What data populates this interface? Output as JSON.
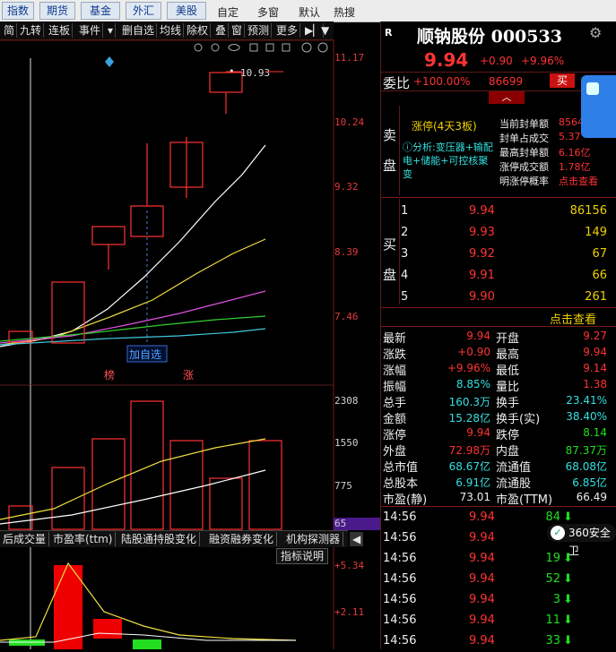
{
  "toolbar": {
    "tabs": [
      "指数",
      "期货",
      "基金",
      "外汇",
      "美股"
    ],
    "links": [
      "自定",
      "多窗",
      "默认",
      "热搜"
    ]
  },
  "chart_toolbar": {
    "items": [
      "简",
      "九转",
      "连板",
      "事件",
      "▾",
      "删自选",
      "均线",
      "除权",
      "叠",
      "窗",
      "预测",
      "更多"
    ]
  },
  "kline": {
    "price_labels": [
      "11.17",
      "10.24",
      "9.32",
      "8.39",
      "7.46"
    ],
    "high_label": "10.93",
    "add_watch": "加自选",
    "markers": [
      "榜",
      "涨"
    ]
  },
  "volume": {
    "labels": [
      "2308",
      "1550",
      "775"
    ],
    "bottom_label": "65"
  },
  "bottom_tabs": [
    "后成交量",
    "市盈率(ttm)",
    "陆股通持股变化",
    "融资融券变化",
    "机构探测器"
  ],
  "indicator": {
    "button": "指标说明",
    "labels": [
      "+5.34",
      "+2.11"
    ]
  },
  "stock": {
    "name": "顺钠股份 000533",
    "price": "9.94",
    "change": "+0.90",
    "pct": "+9.96%",
    "weibi_label": "委比",
    "weibi_value": "+100.00%",
    "weibi_count": "86699",
    "sell_btn": "买"
  },
  "limit_info": {
    "sell_label": "卖盘",
    "status": "涨停(4天3板)",
    "analysis": "ⓘ分析:变压器+输配电+储能+可控核聚变",
    "rows": [
      {
        "k": "当前封单额",
        "v": "8564"
      },
      {
        "k": "封单占成交",
        "v": "5.37"
      },
      {
        "k": "最高封单额",
        "v": "6.16亿"
      },
      {
        "k": "涨停成交额",
        "v": "1.78亿"
      },
      {
        "k": "明涨停概率",
        "v": "点击查看"
      }
    ]
  },
  "order_book": {
    "label": "买盘",
    "rows": [
      {
        "level": "1",
        "price": "9.94",
        "vol": "86156"
      },
      {
        "level": "2",
        "price": "9.93",
        "vol": "149"
      },
      {
        "level": "3",
        "price": "9.92",
        "vol": "67"
      },
      {
        "level": "4",
        "price": "9.91",
        "vol": "66"
      },
      {
        "level": "5",
        "price": "9.90",
        "vol": "261"
      }
    ],
    "view_link": "点击查看"
  },
  "stats": [
    {
      "k1": "最新",
      "v1": "9.94",
      "c1": "red",
      "k2": "开盘",
      "v2": "9.27",
      "c2": "red"
    },
    {
      "k1": "涨跌",
      "v1": "+0.90",
      "c1": "red",
      "k2": "最高",
      "v2": "9.94",
      "c2": "red"
    },
    {
      "k1": "涨幅",
      "v1": "+9.96%",
      "c1": "red",
      "k2": "最低",
      "v2": "9.14",
      "c2": "red"
    },
    {
      "k1": "振幅",
      "v1": "8.85%",
      "c1": "cyan",
      "k2": "量比",
      "v2": "1.38",
      "c2": "red"
    },
    {
      "k1": "总手",
      "v1": "160.3万",
      "c1": "cyan",
      "k2": "换手",
      "v2": "23.41%",
      "c2": "cyan"
    },
    {
      "k1": "金额",
      "v1": "15.28亿",
      "c1": "cyan",
      "k2": "换手(实)",
      "v2": "38.40%",
      "c2": "cyan"
    },
    {
      "k1": "涨停",
      "v1": "9.94",
      "c1": "red",
      "k2": "跌停",
      "v2": "8.14",
      "c2": "grn"
    },
    {
      "k1": "外盘",
      "v1": "72.98万",
      "c1": "red",
      "k2": "内盘",
      "v2": "87.37万",
      "c2": "grn"
    },
    {
      "k1": "总市值",
      "v1": "68.67亿",
      "c1": "cyan",
      "k2": "流通值",
      "v2": "68.08亿",
      "c2": "cyan"
    },
    {
      "k1": "总股本",
      "v1": "6.91亿",
      "c1": "cyan",
      "k2": "流通股",
      "v2": "6.85亿",
      "c2": "cyan"
    },
    {
      "k1": "市盈(静)",
      "v1": "73.01",
      "c1": "wht",
      "k2": "市盈(TTM)",
      "v2": "66.49",
      "c2": "wht"
    }
  ],
  "ticks": [
    {
      "t": "14:56",
      "p": "9.94",
      "v": "84"
    },
    {
      "t": "14:56",
      "p": "9.94",
      "v": "2"
    },
    {
      "t": "14:56",
      "p": "9.94",
      "v": "19"
    },
    {
      "t": "14:56",
      "p": "9.94",
      "v": "52"
    },
    {
      "t": "14:56",
      "p": "9.94",
      "v": "3"
    },
    {
      "t": "14:56",
      "p": "9.94",
      "v": "11"
    },
    {
      "t": "14:56",
      "p": "9.94",
      "v": "33"
    }
  ],
  "overlay": {
    "badge": "360安全卫"
  },
  "colors": {
    "up": "#ff3333",
    "down": "#22dd22",
    "accent": "#33e0e0"
  }
}
